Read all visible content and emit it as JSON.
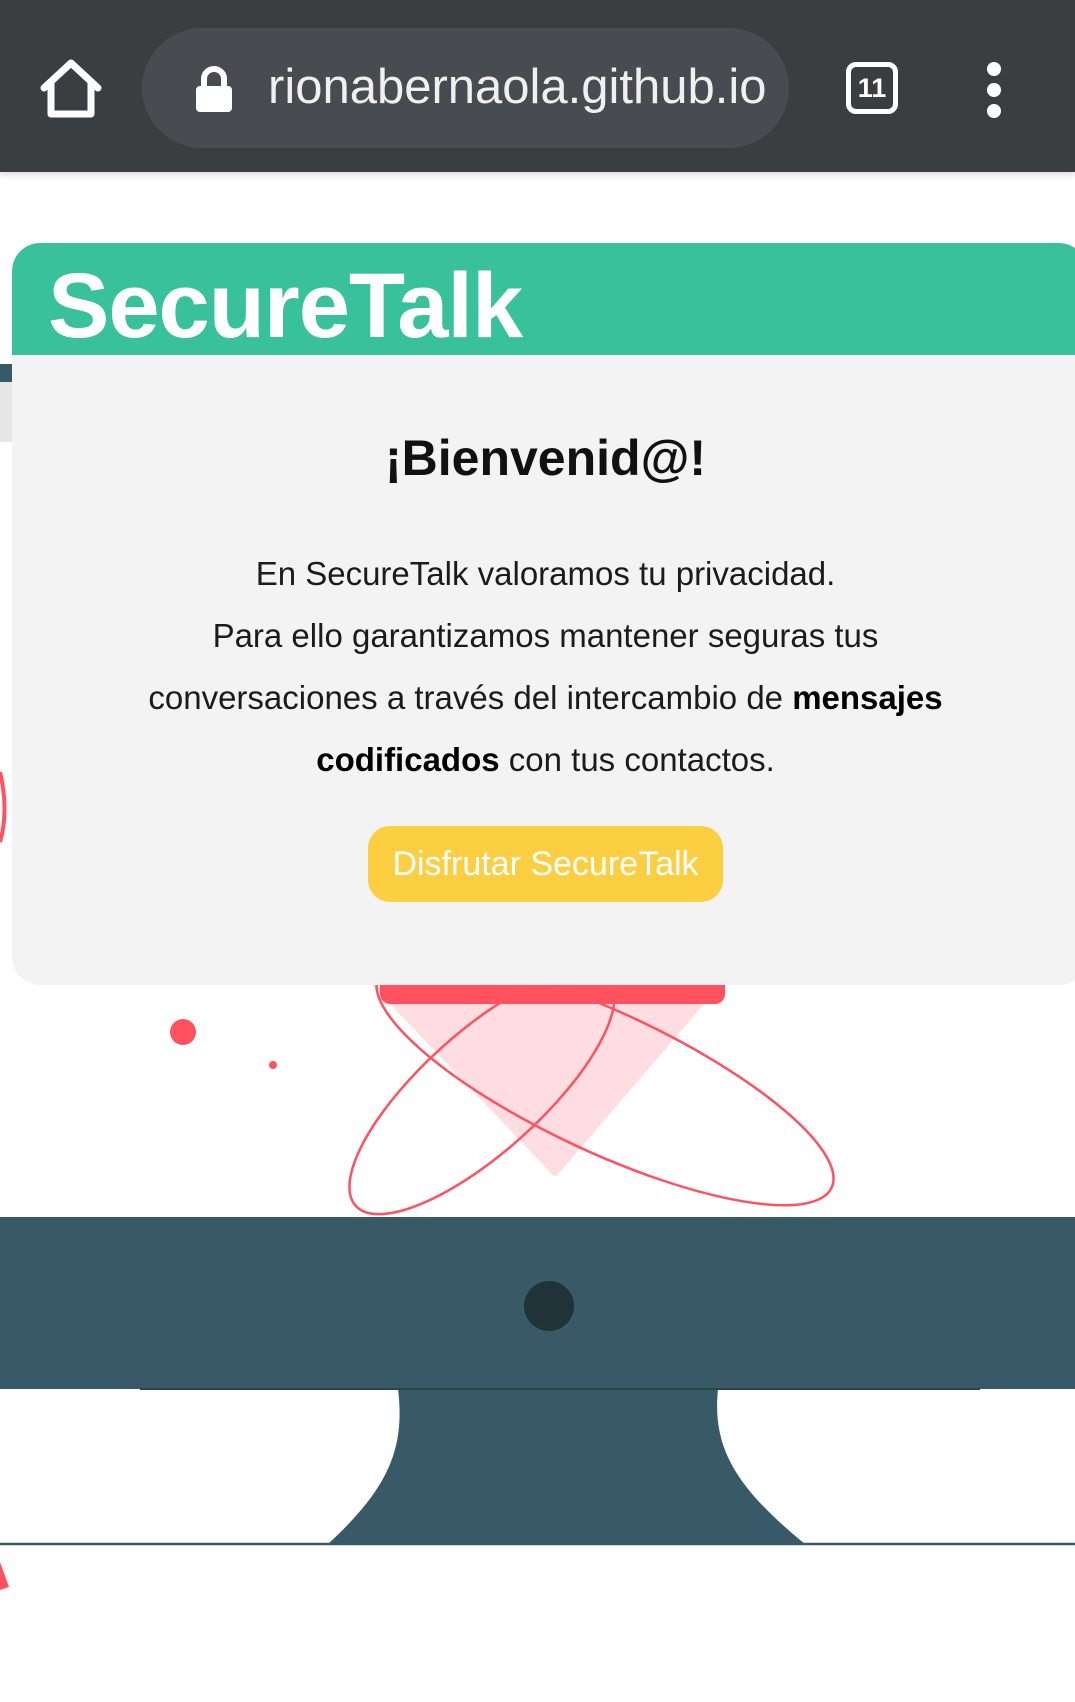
{
  "browser": {
    "url": "rionabernaola.github.io",
    "tab_count": "11",
    "icons": [
      "home-icon",
      "lock-icon",
      "tab-switcher-icon",
      "more-vert-icon"
    ],
    "toolbar_color": "#3b3e41"
  },
  "modal": {
    "brand": "SecureTalk",
    "title": "¡Bienvenid@!",
    "line1": "En SecureTalk valoramos tu privacidad.",
    "line2": "Para ello garantizamos mantener seguras tus",
    "line3_pre": "conversaciones a través del intercambio de ",
    "bold1": "mensajes",
    "bold2": "codificados",
    "line4_post": " con tus contactos.",
    "button": "Disfrutar SecureTalk"
  },
  "colors": {
    "accent_green": "#39c19b",
    "button_yellow": "#fccf43",
    "illustration_red": "#ff5160",
    "monitor_slate": "#385a66"
  }
}
